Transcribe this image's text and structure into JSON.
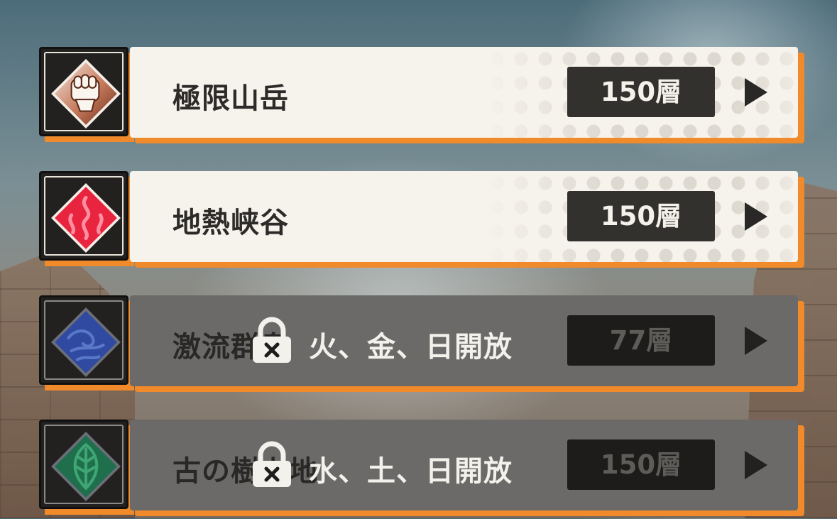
{
  "stages": [
    {
      "name": "極限山岳",
      "floors": "150層",
      "locked": false,
      "open_days": "",
      "icon": "fist-icon",
      "icon_color": "#7a3a22"
    },
    {
      "name": "地熱峡谷",
      "floors": "150層",
      "locked": false,
      "open_days": "",
      "icon": "flame-icon",
      "icon_color": "#e8243f"
    },
    {
      "name": "激流群島",
      "floors": "77層",
      "locked": true,
      "open_days": "火、金、日開放",
      "icon": "wave-icon",
      "icon_color": "#2f4aa0"
    },
    {
      "name": "古の樹上地",
      "floors": "150層",
      "locked": true,
      "open_days": "水、土、日開放",
      "icon": "leaf-icon",
      "icon_color": "#1f6f4c"
    }
  ],
  "colors": {
    "accent": "#f08a2a",
    "bar_bg": "#f6f3ec",
    "locked_bar_bg": "#6b6a68",
    "floor_badge": "#33312e"
  }
}
